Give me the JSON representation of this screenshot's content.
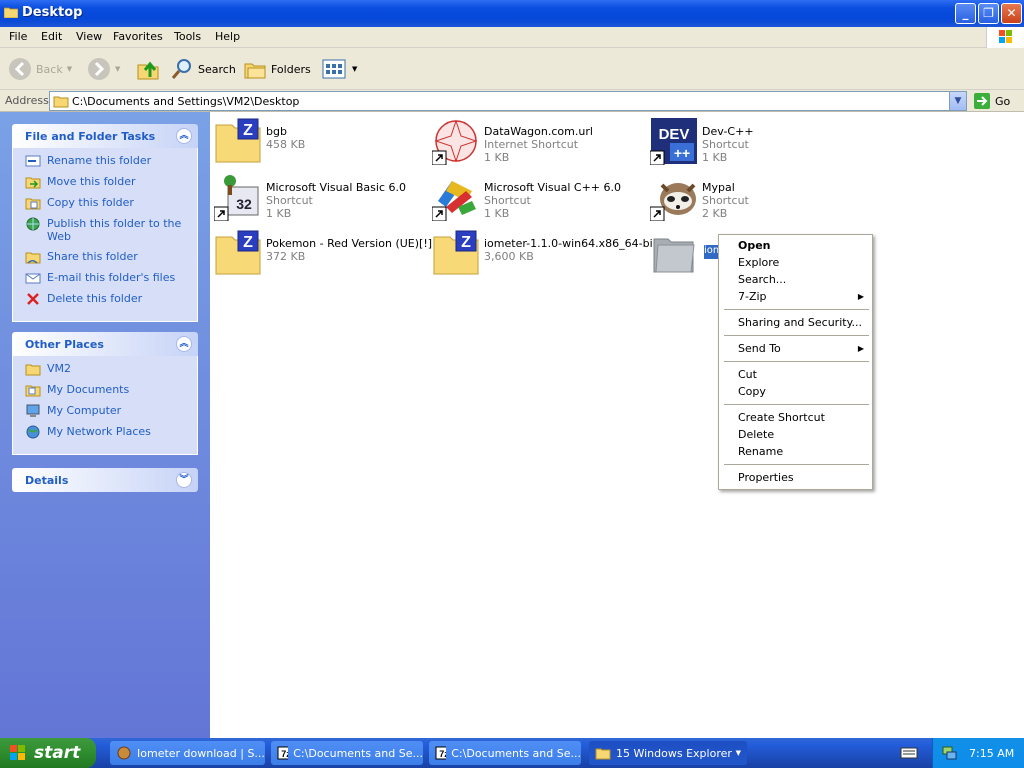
{
  "window": {
    "title": "Desktop"
  },
  "menu": [
    "File",
    "Edit",
    "View",
    "Favorites",
    "Tools",
    "Help"
  ],
  "toolbar": {
    "back": "Back",
    "search": "Search",
    "folders": "Folders"
  },
  "address": {
    "label": "Address",
    "path": "C:\\Documents and Settings\\VM2\\Desktop",
    "go": "Go"
  },
  "tasks": {
    "title": "File and Folder Tasks",
    "items": [
      "Rename this folder",
      "Move this folder",
      "Copy this folder",
      "Publish this folder to the Web",
      "Share this folder",
      "E-mail this folder's files",
      "Delete this folder"
    ]
  },
  "places": {
    "title": "Other Places",
    "items": [
      "VM2",
      "My Documents",
      "My Computer",
      "My Network Places"
    ]
  },
  "details": {
    "title": "Details"
  },
  "files": [
    {
      "name": "bgb",
      "type": "",
      "size": "458 KB",
      "icon": "zip-folder-icon"
    },
    {
      "name": "DataWagon.com.url",
      "type": "Internet Shortcut",
      "size": "1 KB",
      "icon": "url-shortcut-icon"
    },
    {
      "name": "Dev-C++",
      "type": "Shortcut",
      "size": "1 KB",
      "icon": "devcpp-icon"
    },
    {
      "name": "Microsoft Visual Basic 6.0",
      "type": "Shortcut",
      "size": "1 KB",
      "icon": "vb6-icon"
    },
    {
      "name": "Microsoft Visual C++ 6.0",
      "type": "Shortcut",
      "size": "1 KB",
      "icon": "vc6-icon"
    },
    {
      "name": "Mypal",
      "type": "Shortcut",
      "size": "2 KB",
      "icon": "mypal-icon"
    },
    {
      "name": "Pokemon - Red Version (UE)[!]",
      "type": "",
      "size": "372 KB",
      "icon": "zip-folder-icon"
    },
    {
      "name": "iometer-1.1.0-win64.x86_64-bin",
      "type": "",
      "size": "3,600 KB",
      "icon": "zip-folder-icon"
    },
    {
      "name": "iom",
      "type": "",
      "size": "",
      "icon": "folder-icon"
    }
  ],
  "context_menu": {
    "groups": [
      [
        "Open",
        "Explore",
        "Search...",
        "7-Zip"
      ],
      [
        "Sharing and Security..."
      ],
      [
        "Send To"
      ],
      [
        "Cut",
        "Copy"
      ],
      [
        "Create Shortcut",
        "Delete",
        "Rename"
      ],
      [
        "Properties"
      ]
    ]
  },
  "taskbar": {
    "start": "start",
    "buttons": [
      "Iometer download | S...",
      "C:\\Documents and Se...",
      "C:\\Documents and Se...",
      "15 Windows Explorer"
    ],
    "clock": "7:15 AM"
  }
}
